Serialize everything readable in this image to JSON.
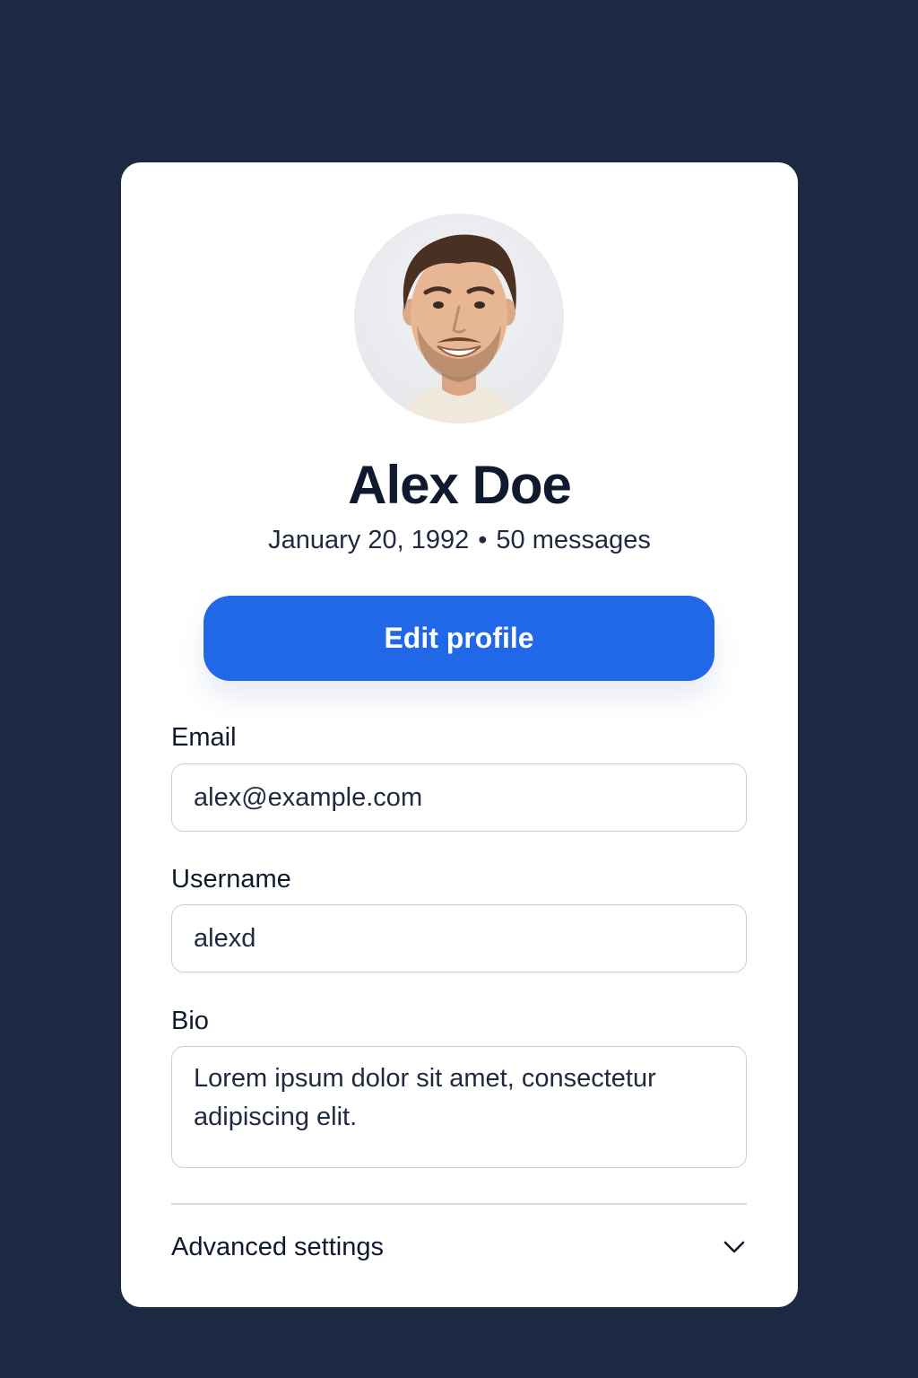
{
  "profile": {
    "name": "Alex Doe",
    "birth_date": "January 20, 1992",
    "separator": "•",
    "messages": "50 messages",
    "edit_button_label": "Edit profile"
  },
  "form": {
    "email": {
      "label": "Email",
      "value": "alex@example.com"
    },
    "username": {
      "label": "Username",
      "value": "alexd"
    },
    "bio": {
      "label": "Bio",
      "value": "Lorem ipsum dolor sit amet, consectetur adipiscing elit."
    }
  },
  "advanced": {
    "label": "Advanced settings",
    "icon": "chevron-down-icon"
  },
  "colors": {
    "background": "#1c2942",
    "card": "#ffffff",
    "accent": "#2168e8",
    "text_primary": "#0f1a2e",
    "field_border": "#c4cedd"
  }
}
